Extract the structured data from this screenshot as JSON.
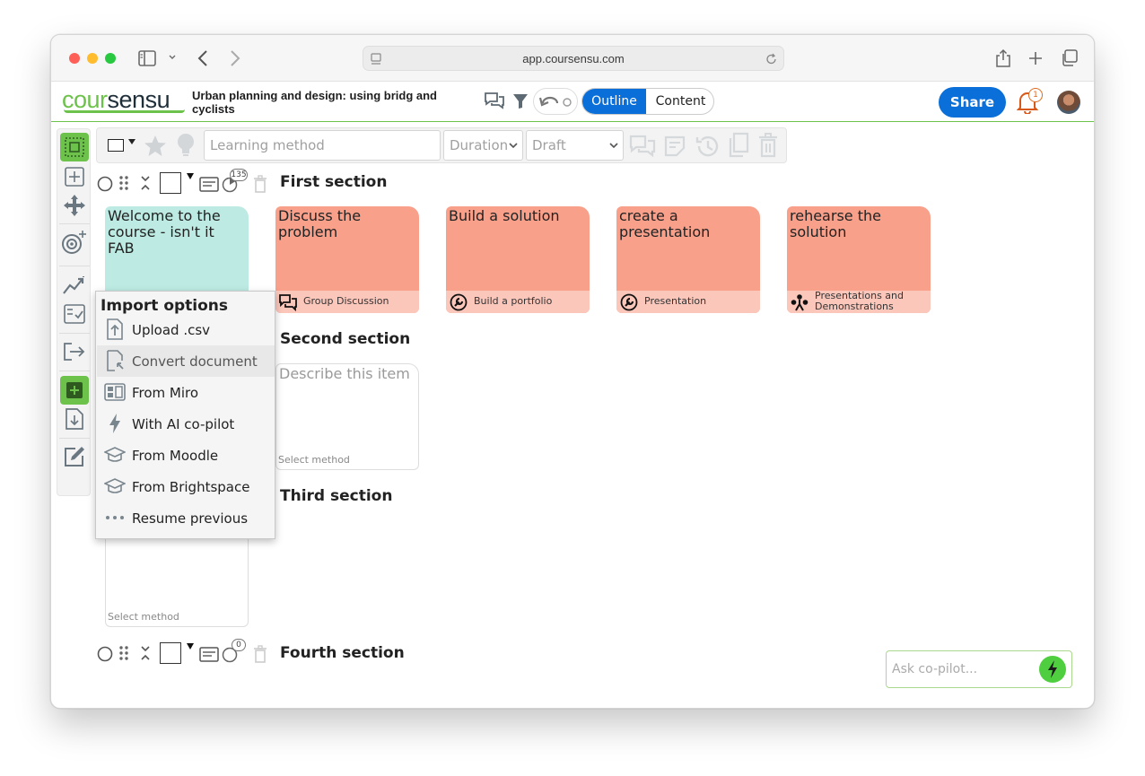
{
  "browser": {
    "url": "app.coursensu.com"
  },
  "header": {
    "logo_part1": "cour",
    "logo_part2": "sensu",
    "course_title": "Urban planning and design: using bridg and cyclists",
    "view_outline": "Outline",
    "view_content": "Content",
    "share_label": "Share",
    "notification_count": "1"
  },
  "toolbar": {
    "learning_method_placeholder": "Learning method",
    "duration_value": "Duration",
    "status_value": "Draft"
  },
  "sections": [
    {
      "title": "First section",
      "counter": "135",
      "cards": [
        {
          "text": "Welcome to the course - isn't it FAB",
          "method": "",
          "color": "#bdebe3"
        },
        {
          "text": "Discuss the problem",
          "method": "Group Discussion",
          "icon": "chat-icon",
          "color": "#f9a08b"
        },
        {
          "text": "Build a solution",
          "method": "Build a portfolio",
          "icon": "wrench-icon",
          "color": "#f9a08b"
        },
        {
          "text": "create a presentation",
          "method": "Presentation",
          "icon": "wrench-icon",
          "color": "#f9a08b"
        },
        {
          "text": "rehearse the solution",
          "method": "Presentations and Demonstrations",
          "icon": "people-icon",
          "color": "#f9a08b"
        }
      ]
    },
    {
      "title": "Second section",
      "cards": [
        {
          "text": "Describe this item",
          "method": "Select method"
        }
      ]
    },
    {
      "title": "Third section",
      "cards": [
        {
          "method": "Select method"
        }
      ]
    },
    {
      "title": "Fourth section",
      "counter": "0"
    }
  ],
  "import_menu": {
    "title": "Import options",
    "items": [
      {
        "label": "Upload .csv",
        "icon": "upload-file-icon"
      },
      {
        "label": "Convert document",
        "icon": "convert-document-icon"
      },
      {
        "label": "From Miro",
        "icon": "miro-board-icon"
      },
      {
        "label": "With AI co-pilot",
        "icon": "lightning-icon"
      },
      {
        "label": "From Moodle",
        "icon": "graduation-cap-icon"
      },
      {
        "label": "From Brightspace",
        "icon": "graduation-cap-icon"
      },
      {
        "label": "Resume previous",
        "icon": "ellipsis-icon"
      }
    ]
  },
  "copilot": {
    "placeholder": "Ask co-pilot..."
  },
  "colors": {
    "brand_green": "#6cc24a",
    "brand_blue": "#0a6fd8",
    "card_salmon": "#f9a08b",
    "card_mint": "#bdebe3"
  }
}
